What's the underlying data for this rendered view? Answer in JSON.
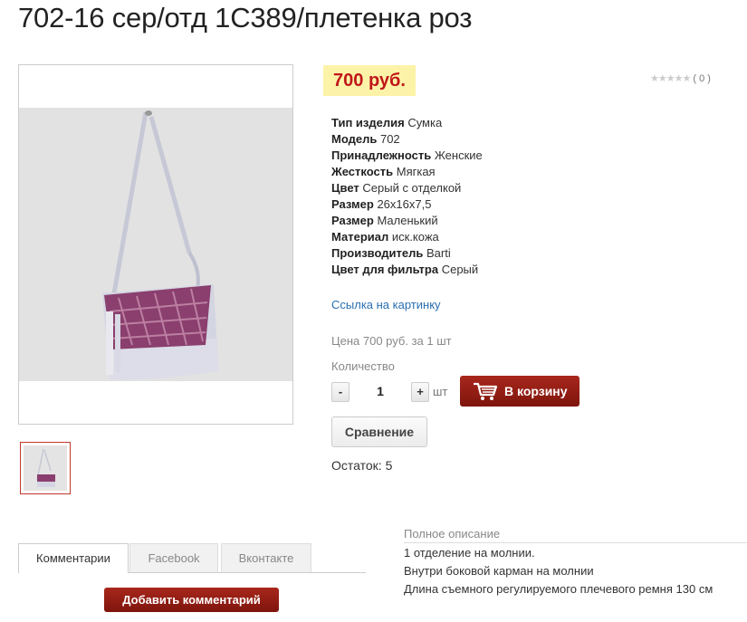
{
  "product": {
    "title": "702-16 сер/отд 1С389/плетенка роз",
    "price": "700 руб.",
    "rating_count": "( 0 )",
    "properties": [
      {
        "key": "Тип изделия",
        "value": "Сумка"
      },
      {
        "key": "Модель",
        "value": "702"
      },
      {
        "key": "Принадлежность",
        "value": "Женские"
      },
      {
        "key": "Жесткость",
        "value": "Мягкая"
      },
      {
        "key": "Цвет",
        "value": "Серый с отделкой"
      },
      {
        "key": "Размер",
        "value": "26x16x7,5"
      },
      {
        "key": "Размер",
        "value": "Маленький"
      },
      {
        "key": "Материал",
        "value": "иск.кожа"
      },
      {
        "key": "Производитель",
        "value": "Barti"
      },
      {
        "key": "Цвет для фильтра",
        "value": "Серый"
      }
    ],
    "image_link": "Ссылка на картинку",
    "price_note": "Цена 700 руб. за 1 шт",
    "quantity_label": "Количество",
    "quantity_value": "1",
    "minus": "-",
    "plus": "+",
    "unit": "шт",
    "cart_button": "В корзину",
    "compare_button": "Сравнение",
    "stock": "Остаток: 5"
  },
  "tabs": [
    "Комментарии",
    "Facebook",
    "Вконтакте"
  ],
  "add_comment_button": "Добавить комментарий",
  "description": {
    "heading": "Полное описание",
    "lines": [
      "1 отделение на молнии.",
      "Внутри боковой карман на молнии",
      "Длина съемного регулируемого плечевого ремня 130 см"
    ]
  },
  "colors": {
    "price_bg": "#fdf3a8",
    "price_text": "#c0171b",
    "button_red": "#8e1b12",
    "link": "#2a6fb0"
  }
}
